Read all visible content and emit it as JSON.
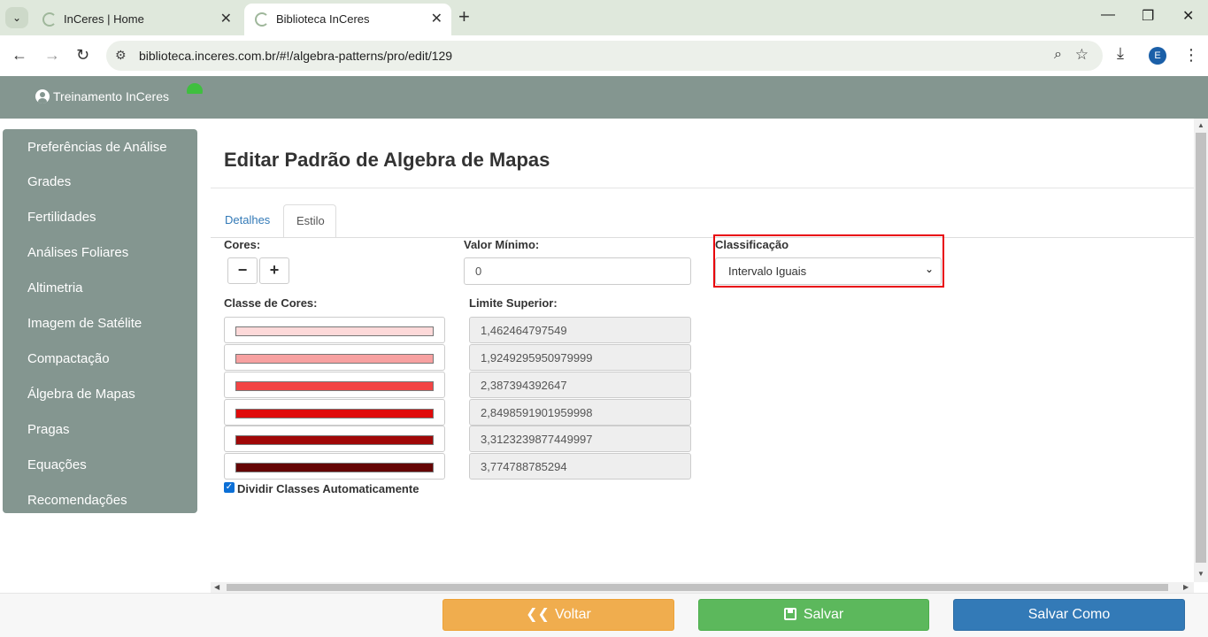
{
  "browser": {
    "tabs": [
      {
        "title": "InCeres | Home"
      },
      {
        "title": "Biblioteca InCeres"
      }
    ],
    "url": "biblioteca.inceres.com.br/#!/algebra-patterns/pro/edit/129",
    "profile_initial": "E"
  },
  "header": {
    "user": "Treinamento InCeres"
  },
  "sidebar": {
    "items": [
      {
        "label": "Preferências de Análise"
      },
      {
        "label": "Grades"
      },
      {
        "label": "Fertilidades"
      },
      {
        "label": "Análises Foliares"
      },
      {
        "label": "Altimetria"
      },
      {
        "label": "Imagem de Satélite"
      },
      {
        "label": "Compactação"
      },
      {
        "label": "Álgebra de Mapas"
      },
      {
        "label": "Pragas"
      },
      {
        "label": "Equações"
      },
      {
        "label": "Recomendações"
      }
    ]
  },
  "main": {
    "title": "Editar Padrão de Algebra de Mapas",
    "tabs": [
      {
        "label": "Detalhes"
      },
      {
        "label": "Estilo"
      }
    ],
    "cores_label": "Cores:",
    "minus": "−",
    "plus": "+",
    "valor_minimo_label": "Valor Mínimo:",
    "valor_minimo": "0",
    "classificacao_label": "Classificação",
    "classificacao_value": "Intervalo Iguais",
    "classe_cores_label": "Classe de Cores:",
    "limite_superior_label": "Limite Superior:",
    "classes": [
      {
        "color": "#fdd9d9",
        "limit": "1,462464797549"
      },
      {
        "color": "#f7a1a1",
        "limit": "1,9249295950979999"
      },
      {
        "color": "#f24444",
        "limit": "2,387394392647"
      },
      {
        "color": "#e00a0a",
        "limit": "2,8498591901959998"
      },
      {
        "color": "#a00808",
        "limit": "3,3123239877449997"
      },
      {
        "color": "#650505",
        "limit": "3,774788785294"
      }
    ],
    "auto_divide_label": "Dividir Classes Automaticamente",
    "auto_divide_checked": true
  },
  "footer": {
    "voltar": "Voltar",
    "salvar": "Salvar",
    "salvar_como": "Salvar Como"
  },
  "colors": {
    "header_bg": "#849690",
    "voltar": "#f0ad4e",
    "salvar": "#5cb85c",
    "salvar_como": "#337ab7",
    "highlight": "#e8000b"
  }
}
